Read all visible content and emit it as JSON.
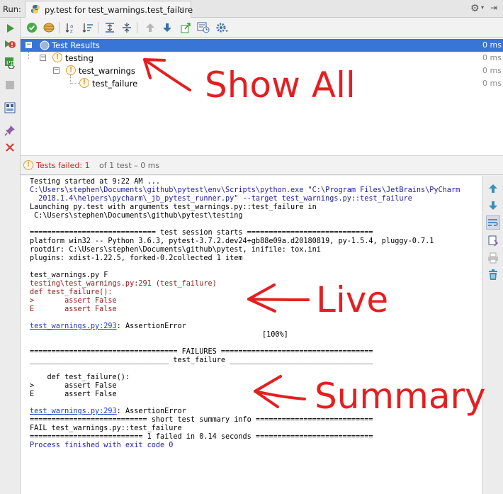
{
  "tabbar": {
    "run_label": "Run:",
    "tab_title": "py.test for test_warnings.test_failure",
    "close_glyph": "×"
  },
  "tree": {
    "rows": [
      {
        "label": "Test Results",
        "time": "0 ms"
      },
      {
        "label": "testing",
        "time": "0 ms"
      },
      {
        "label": "test_warnings",
        "time": "0 ms"
      },
      {
        "label": "test_failure",
        "time": "0 ms"
      }
    ]
  },
  "status": {
    "failed_label": "Tests failed:",
    "failed_count": "1",
    "rest": "of 1 test – 0 ms"
  },
  "console": {
    "lines": [
      "Testing started at 9:22 AM ...",
      "C:\\Users\\stephen\\Documents\\github\\pytest\\env\\Scripts\\python.exe \"C:\\Program Files\\JetBrains\\PyCharm",
      "  2018.1.4\\helpers\\pycharm\\_jb_pytest_runner.py\" --target test_warnings.py::test_failure",
      "Launching py.test with arguments test_warnings.py::test_failure in",
      " C:\\Users\\stephen\\Documents\\github\\pytest\\testing",
      "============================= test session starts =============================",
      "platform win32 -- Python 3.6.3, pytest-3.7.2.dev24+gb88e09a.d20180819, py-1.5.4, pluggy-0.7.1",
      "rootdir: C:\\Users\\stephen\\Documents\\github\\pytest, inifile: tox.ini",
      "plugins: xdist-1.22.5, forked-0.2collected 1 item",
      "test_warnings.py F",
      "testing\\test_warnings.py:291 (test_failure)",
      "def test_failure():",
      ">       assert False",
      "E       assert False",
      "test_warnings.py:293",
      ": AssertionError",
      "[100%]",
      "================================== FAILURES ===================================",
      "________________________________ test_failure _________________________________",
      "    def test_failure():",
      ">       assert False",
      "E       assert False",
      "test_warnings.py:293",
      ": AssertionError",
      "=========================== short test summary info ===========================",
      "FAIL test_warnings.py::test_failure",
      "========================== 1 failed in 0.14 seconds ===========================",
      "Process finished with exit code 0"
    ]
  },
  "annotations": {
    "show_all": "Show All",
    "live": "Live",
    "summary": "Summary",
    "color": "#e41f1f"
  },
  "colors": {
    "selection": "#3875d7",
    "warning": "#e2a03f",
    "failed": "#c7261c"
  }
}
